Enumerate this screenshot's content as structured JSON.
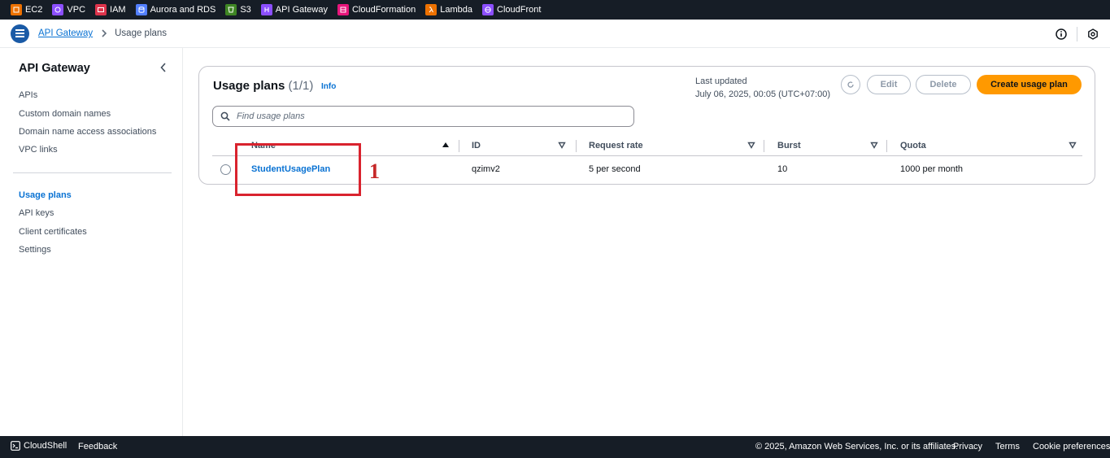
{
  "favorites": [
    {
      "label": "EC2",
      "color": "#ed7100",
      "icon": "ec2-icon"
    },
    {
      "label": "VPC",
      "color": "#8c4fff",
      "icon": "vpc-icon"
    },
    {
      "label": "IAM",
      "color": "#dd344c",
      "icon": "iam-icon"
    },
    {
      "label": "Aurora and RDS",
      "color": "#527fff",
      "icon": "rds-icon"
    },
    {
      "label": "S3",
      "color": "#3f8624",
      "icon": "s3-icon"
    },
    {
      "label": "API Gateway",
      "color": "#8c4fff",
      "icon": "api-gateway-icon"
    },
    {
      "label": "CloudFormation",
      "color": "#e7157b",
      "icon": "cloudformation-icon"
    },
    {
      "label": "Lambda",
      "color": "#ed7100",
      "icon": "lambda-icon"
    },
    {
      "label": "CloudFront",
      "color": "#8c4fff",
      "icon": "cloudfront-icon"
    }
  ],
  "breadcrumb": {
    "parent": "API Gateway",
    "current": "Usage plans"
  },
  "sidebar": {
    "title": "API Gateway",
    "group1": [
      "APIs",
      "Custom domain names",
      "Domain name access associations",
      "VPC links"
    ],
    "group2": [
      "Usage plans",
      "API keys",
      "Client certificates",
      "Settings"
    ],
    "active": "Usage plans"
  },
  "card": {
    "title": "Usage plans",
    "count": "(1/1)",
    "info": "Info",
    "last_updated_label": "Last updated",
    "last_updated_value": "July 06, 2025, 00:05 (UTC+07:00)",
    "edit_label": "Edit",
    "delete_label": "Delete",
    "create_label": "Create usage plan",
    "search_placeholder": "Find usage plans"
  },
  "table": {
    "columns": [
      "Name",
      "ID",
      "Request rate",
      "Burst",
      "Quota"
    ],
    "rows": [
      {
        "name": "StudentUsagePlan",
        "id": "qzimv2",
        "request_rate": "5 per second",
        "burst": "10",
        "quota": "1000 per month"
      }
    ]
  },
  "annotation": {
    "label": "1",
    "color": "#d9232e"
  },
  "footer": {
    "cloudshell": "CloudShell",
    "feedback": "Feedback",
    "copyright": "© 2025, Amazon Web Services, Inc. or its affiliates.",
    "privacy": "Privacy",
    "terms": "Terms",
    "cookies": "Cookie preferences"
  },
  "colors": {
    "accent": "#0972d3",
    "primary_button": "#ff9900",
    "nav_bg": "#161d26"
  }
}
